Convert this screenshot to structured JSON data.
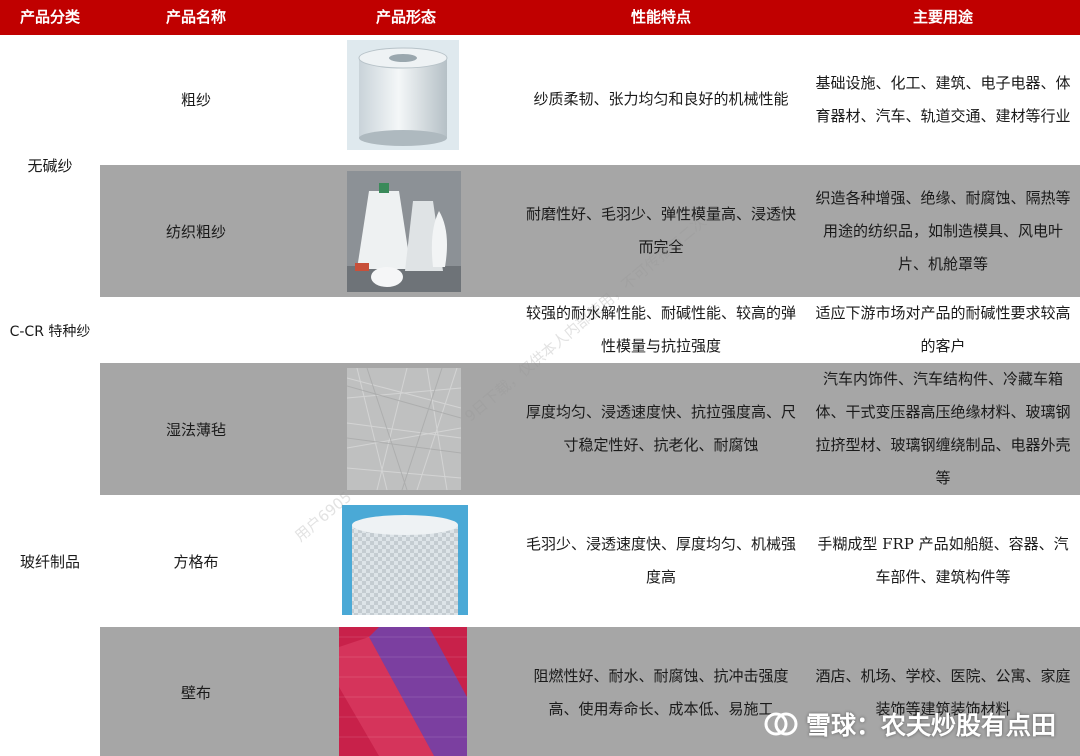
{
  "header": {
    "col_category": "产品分类",
    "col_name": "产品名称",
    "col_form": "产品形态",
    "col_features": "性能特点",
    "col_uses": "主要用途"
  },
  "categories": {
    "alkali_free_yarn": "无碱纱",
    "c_cr_yarn": "C-CR 特种纱",
    "fiberglass_products": "玻纤制品"
  },
  "rows": [
    {
      "name": "粗纱",
      "features": "纱质柔韧、张力均匀和良好的机械性能",
      "uses": "基础设施、化工、建筑、电子电器、体育器材、汽车、轨道交通、建材等行业"
    },
    {
      "name": "纺织粗纱",
      "features": "耐磨性好、毛羽少、弹性模量高、浸透快而完全",
      "uses": "织造各种增强、绝缘、耐腐蚀、隔热等用途的纺织品，如制造模具、风电叶片、机舱罩等"
    },
    {
      "name": "",
      "features": "较强的耐水解性能、耐碱性能、较高的弹性模量与抗拉强度",
      "uses": "适应下游市场对产品的耐碱性要求较高的客户"
    },
    {
      "name": "湿法薄毡",
      "features": "厚度均匀、浸透速度快、抗拉强度高、尺寸稳定性好、抗老化、耐腐蚀",
      "uses": "汽车内饰件、汽车结构件、冷藏车箱体、干式变压器高压绝缘材料、玻璃钢拉挤型材、玻璃钢缠绕制品、电器外壳等"
    },
    {
      "name": "方格布",
      "features": "毛羽少、浸透速度快、厚度均匀、机械强度高",
      "uses": "手糊成型 FRP 产品如船艇、容器、汽车部件、建筑构件等"
    },
    {
      "name": "壁布",
      "features": "阻燃性好、耐水、耐腐蚀、抗冲击强度高、使用寿命长、成本低、易施工",
      "uses": "酒店、机场、学校、医院、公寓、家庭装饰等建筑装饰材料"
    }
  ],
  "watermark": {
    "line1": "用户6905",
    "line2": "9日下载，仅供本人内部使用，不可传播与二次"
  },
  "brand": {
    "text": "雪球：农夫炒股有点田",
    "icon": "snowball-logo-icon"
  }
}
